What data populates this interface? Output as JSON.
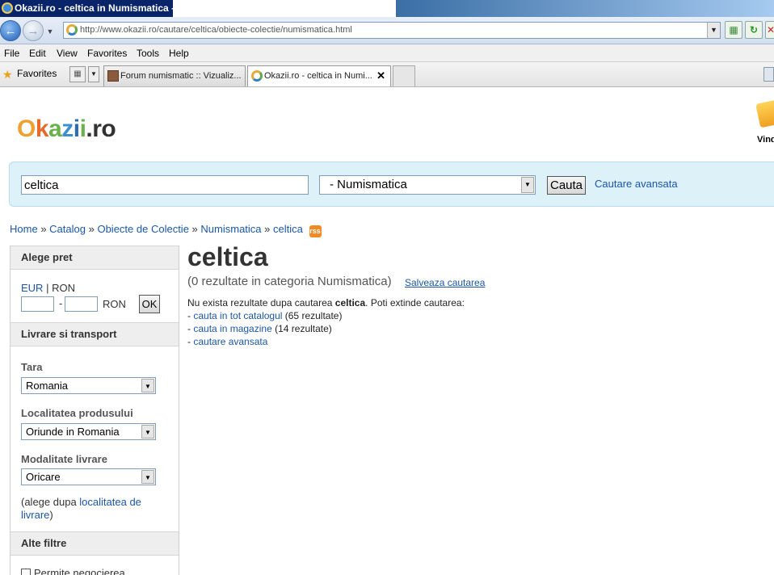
{
  "window": {
    "title": "Okazii.ro - celtica in Numismatica -"
  },
  "address": {
    "url": "http://www.okazii.ro/cautare/celtica/obiecte-colectie/numismatica.html"
  },
  "menu": [
    "File",
    "Edit",
    "View",
    "Favorites",
    "Tools",
    "Help"
  ],
  "favorites": {
    "label": "Favorites"
  },
  "tabs": [
    {
      "label": "Forum numismatic :: Vizualiz..."
    },
    {
      "label": "Okazii.ro - celtica in Numi..."
    }
  ],
  "logo": {
    "o": "O",
    "k": "k",
    "a": "a",
    "z": "z",
    "i1": "i",
    "i2": "i",
    "rest": ".ro"
  },
  "sell": {
    "label": "Vind"
  },
  "search": {
    "query": "celtica",
    "category": "- Numismatica",
    "button": "Cauta",
    "advanced": "Cautare avansata"
  },
  "breadcrumb": {
    "home": "Home",
    "catalog": "Catalog",
    "collection": "Obiecte de Colectie",
    "numismatics": "Numismatica",
    "current": "celtica",
    "separator": "»",
    "rss": "rss"
  },
  "sidebar": {
    "price_head": "Alege pret",
    "eur": "EUR",
    "pipe": "|",
    "ron": "RON",
    "dash": "-",
    "ron_unit": "RON",
    "ok": "OK",
    "delivery_head": "Livrare si transport",
    "country_label": "Tara",
    "country_value": "Romania",
    "location_label": "Localitatea produsului",
    "location_value": "Oriunde in Romania",
    "mode_label": "Modalitate livrare",
    "mode_value": "Oricare",
    "note_prefix": "(alege dupa",
    "note_link_1": "localitatea de",
    "note_link_2": "livrare",
    "note_suffix": ")",
    "other_head": "Alte filtre",
    "negotiate": "Permite negocierea"
  },
  "main": {
    "title": "celtica",
    "results": "(0 rezultate in categoria Numismatica)",
    "save_search": "Salveaza cautarea",
    "no_results_prefix": "Nu exista rezultate dupa cautarea",
    "no_results_term": "celtica",
    "no_results_suffix": ". Poti extinde cautarea:",
    "opt1_dash": "-",
    "opt1_link": "cauta in tot catalogul",
    "opt1_count": "(65 rezultate)",
    "opt2_dash": "-",
    "opt2_link": "cauta in magazine",
    "opt2_count": "(14 rezultate)",
    "opt3_dash": "-",
    "opt3_link": "cautare avansata"
  }
}
